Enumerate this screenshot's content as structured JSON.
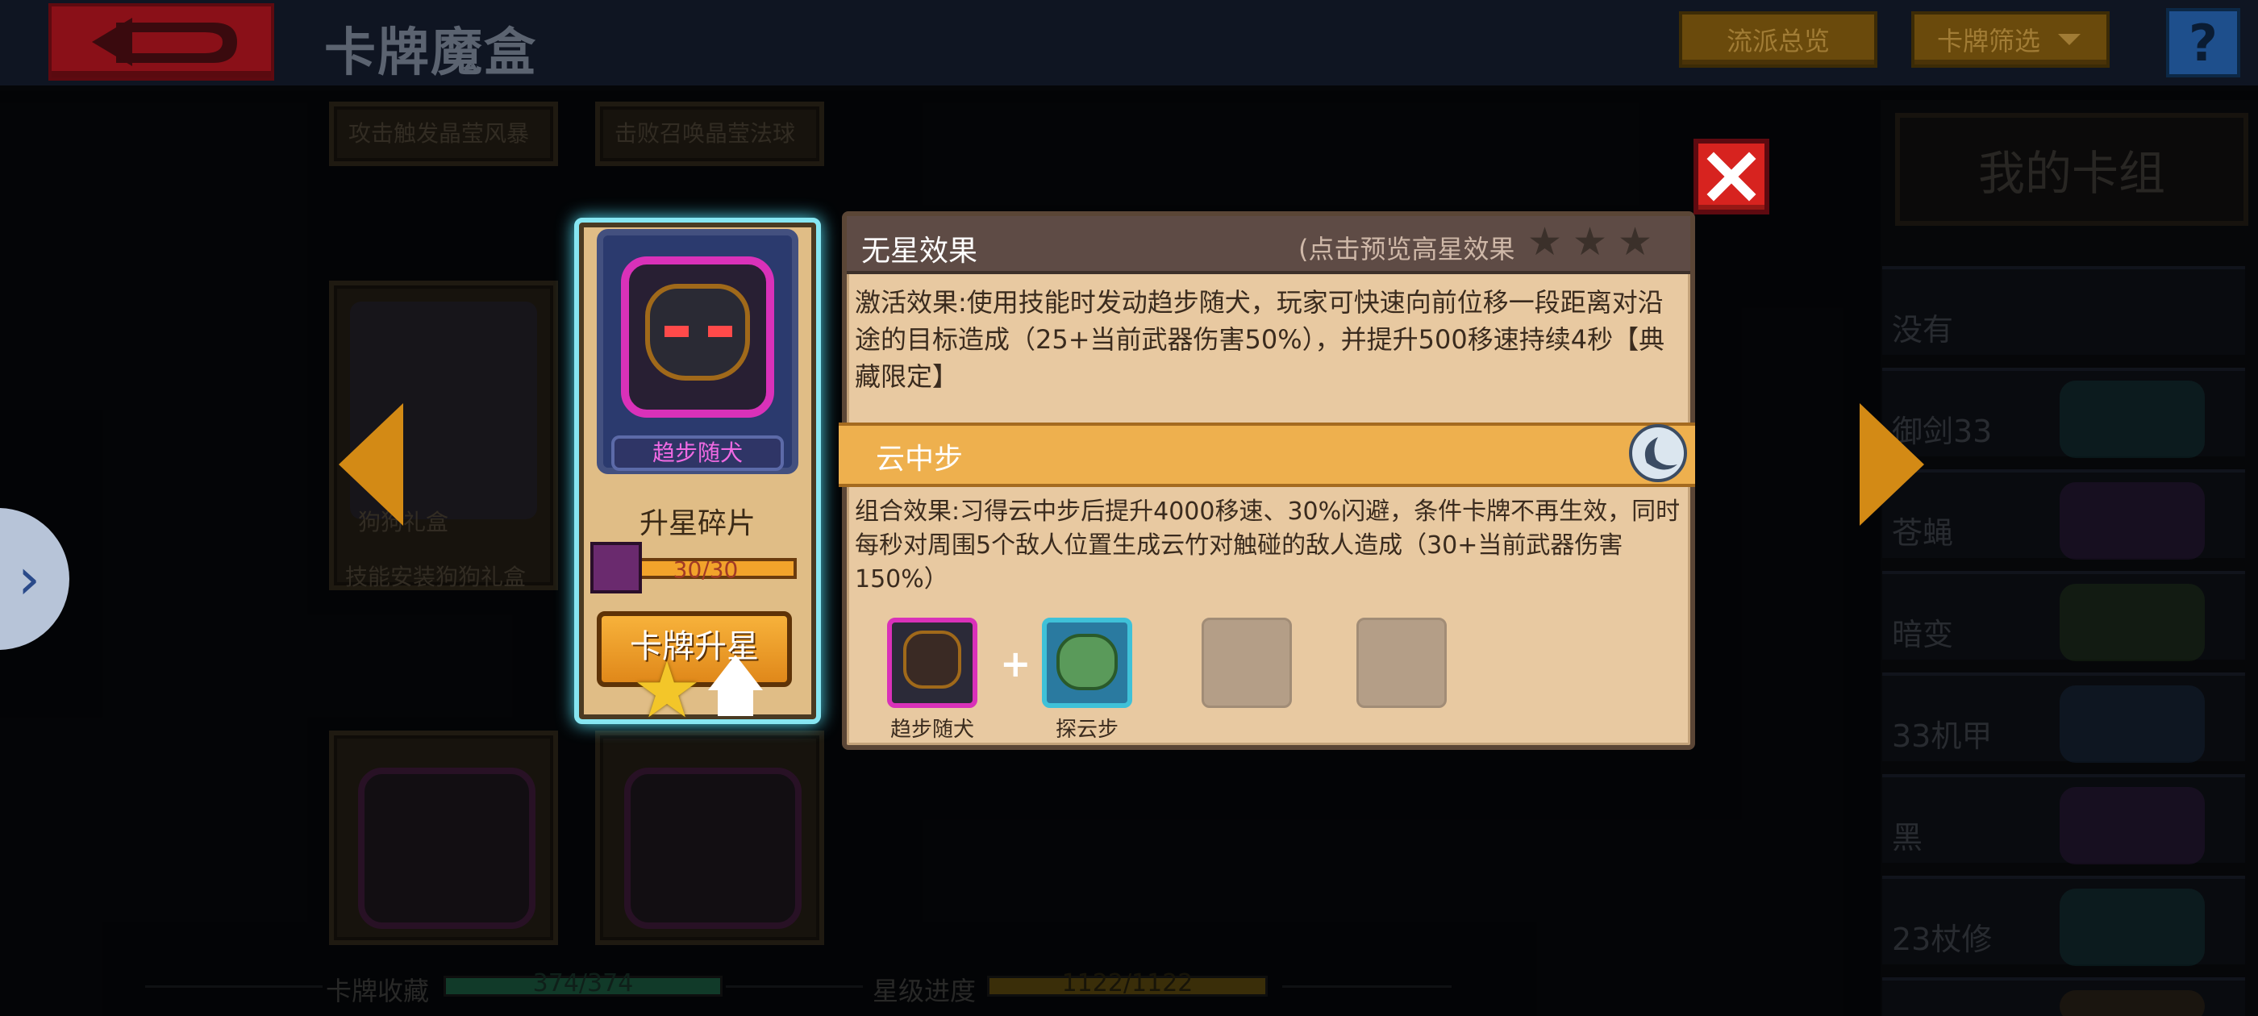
{
  "header": {
    "title": "卡牌魔盒",
    "build_overview": "流派总览",
    "card_filter": "卡牌筛选",
    "help": "?"
  },
  "background_cards": [
    {
      "label": "技能安装狗狗礼盒",
      "sub": "狗狗礼盒"
    },
    {
      "label": "攻击触发晶莹风暴"
    },
    {
      "label": "击败召唤晶莹法球"
    }
  ],
  "deck": {
    "title": "我的卡组",
    "items": [
      "没有",
      "御剑33",
      "苍蝇",
      "暗变",
      "33机甲",
      "黑",
      "23杖修"
    ]
  },
  "card": {
    "name": "趋步随犬",
    "fragment_title": "升星碎片",
    "fragments": "30/30",
    "fragments_fraction": 1.0,
    "upgrade_button": "卡牌升星"
  },
  "info": {
    "title": "无星效果",
    "hint": "(点击预览高星效果",
    "stars_filled": 0,
    "stars_total": 3,
    "description": "激活效果:使用技能时发动趋步随犬，玩家可快速向前位移一段距离对沿途的目标造成（25+当前武器伤害50%），并提升500移速持续4秒【典藏限定】",
    "combo_name": "云中步",
    "combo_description": "组合效果:习得云中步后提升4000移速、30%闪避，条件卡牌不再生效，同时每秒对周围5个敌人位置生成云竹对触碰的敌人造成（30+当前武器伤害150%）",
    "combo_cards": [
      "趋步随犬",
      "探云步"
    ],
    "plus": "+"
  },
  "footer": {
    "collection_label": "卡牌收藏",
    "collection_value": "374/374",
    "collection_fraction": 1.0,
    "star_label": "星级进度",
    "star_value": "1122/1122",
    "star_fraction": 1.0
  },
  "colors": {
    "accent_gold": "#eeb04e",
    "panel_bg": "#e8c9a1",
    "glow": "#86e6f2",
    "close_red": "#d7231f"
  }
}
